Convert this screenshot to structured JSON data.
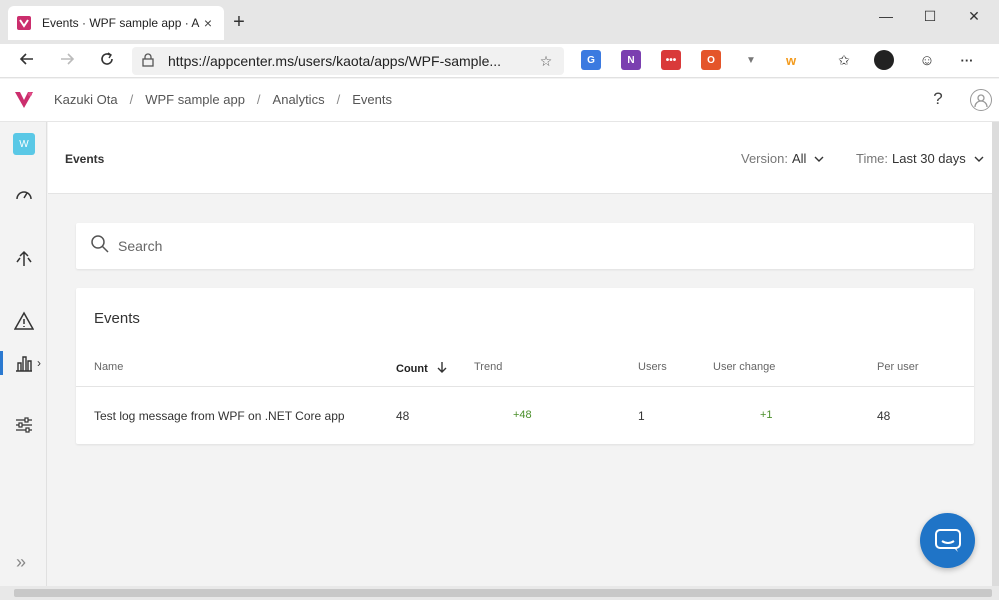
{
  "browser": {
    "tab_title": "Events · WPF sample app · App C",
    "tab_close": "×",
    "new_tab": "+",
    "url": "https://appcenter.ms/users/kaota/apps/WPF-sample...",
    "window_controls": {
      "minimize": "—",
      "maximize": "☐",
      "close": "✕"
    },
    "extension_labels": {
      "w": "w",
      "more": "···"
    }
  },
  "header": {
    "breadcrumb": [
      "Kazuki Ota",
      "WPF sample app",
      "Analytics",
      "Events"
    ],
    "separator": "/",
    "help": "?"
  },
  "sidebar": {
    "app_initial": "W",
    "items": [
      "app",
      "overview",
      "distribute",
      "diagnostics",
      "analytics",
      "settings"
    ],
    "active_item": "analytics",
    "expand_glyph": "»"
  },
  "page": {
    "title": "Events",
    "version_label": "Version:",
    "version_value": "All",
    "time_label": "Time:",
    "time_value": "Last 30 days"
  },
  "search": {
    "placeholder": "Search"
  },
  "events_card": {
    "title": "Events",
    "columns": [
      "Name",
      "Count",
      "Trend",
      "Users",
      "User change",
      "Per user"
    ],
    "sort_column": "Count",
    "rows": [
      {
        "name": "Test log message from WPF on .NET Core app",
        "count": "48",
        "trend": "+48",
        "users": "1",
        "user_change": "+1",
        "per_user": "48"
      }
    ]
  },
  "colors": {
    "accent": "#1f74c7",
    "positive": "#4a8f2a",
    "app_tile": "#5ac8e6",
    "brand": "#cb2e6d"
  }
}
